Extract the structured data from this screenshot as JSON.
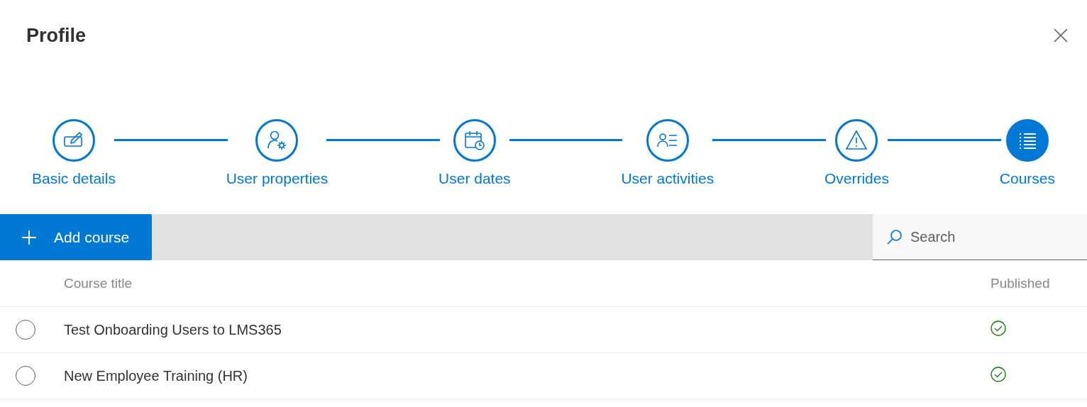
{
  "dialog": {
    "title": "Profile"
  },
  "steps": [
    {
      "label": "Basic details",
      "selected": false
    },
    {
      "label": "User properties",
      "selected": false
    },
    {
      "label": "User dates",
      "selected": false
    },
    {
      "label": "User activities",
      "selected": false
    },
    {
      "label": "Overrides",
      "selected": false
    },
    {
      "label": "Courses",
      "selected": true
    }
  ],
  "toolbar": {
    "add_button": "Add course",
    "search": {
      "placeholder": "Search"
    }
  },
  "table": {
    "columns": [
      "Course title",
      "Published"
    ],
    "rows": [
      {
        "title": "Test Onboarding Users to LMS365",
        "selected": false,
        "published": true
      },
      {
        "title": "New Employee Training (HR)",
        "selected": false,
        "published": true
      }
    ]
  }
}
